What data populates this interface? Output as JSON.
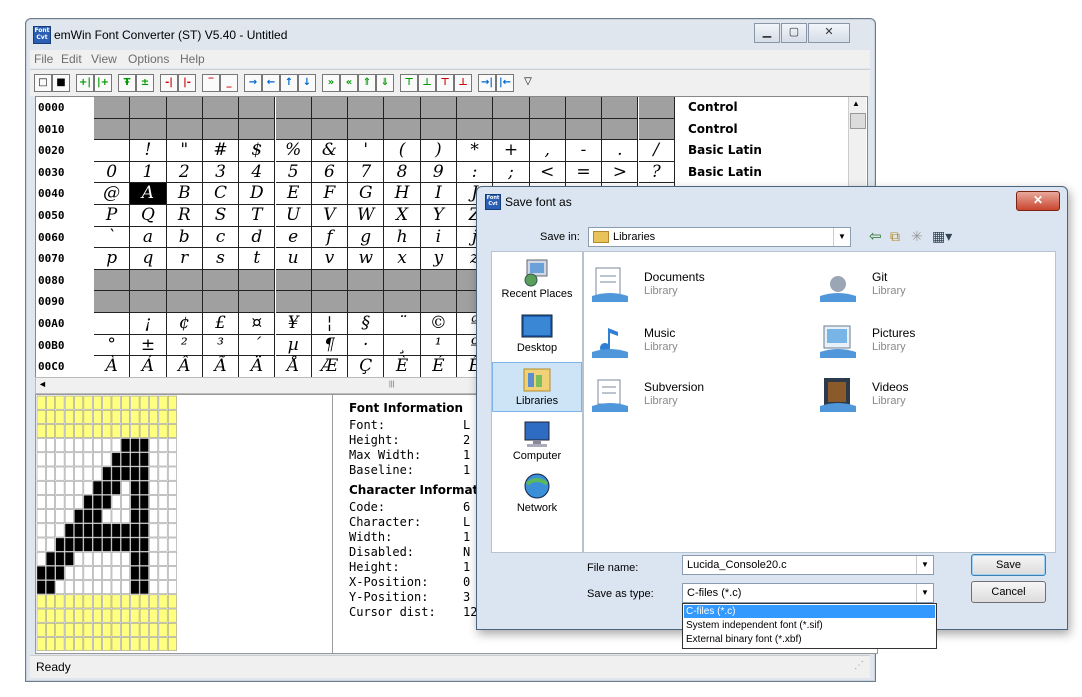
{
  "main_window": {
    "title": "emWin Font Converter (ST) V5.40 - Untitled",
    "menu": [
      "File",
      "Edit",
      "View",
      "Options",
      "Help"
    ],
    "statusbar": "Ready"
  },
  "char_table": {
    "rows": [
      {
        "code": "0000",
        "category": "Control",
        "chars": [
          "",
          "",
          "",
          "",
          "",
          "",
          "",
          "",
          "",
          "",
          "",
          "",
          "",
          "",
          "",
          ""
        ],
        "disabled": true
      },
      {
        "code": "0010",
        "category": "Control",
        "chars": [
          "",
          "",
          "",
          "",
          "",
          "",
          "",
          "",
          "",
          "",
          "",
          "",
          "",
          "",
          "",
          ""
        ],
        "disabled": true
      },
      {
        "code": "0020",
        "category": "Basic Latin",
        "chars": [
          "",
          "!",
          "\"",
          "#",
          "$",
          "%",
          "&",
          "'",
          "(",
          ")",
          "*",
          "+",
          ",",
          "-",
          ".",
          "/"
        ],
        "disabled": false
      },
      {
        "code": "0030",
        "category": "Basic Latin",
        "chars": [
          "0",
          "1",
          "2",
          "3",
          "4",
          "5",
          "6",
          "7",
          "8",
          "9",
          ":",
          ";",
          "<",
          "=",
          ">",
          "?"
        ],
        "disabled": false
      },
      {
        "code": "0040",
        "category": "",
        "chars": [
          "@",
          "A",
          "B",
          "C",
          "D",
          "E",
          "F",
          "G",
          "H",
          "I",
          "J",
          "",
          "",
          "",
          "",
          ""
        ],
        "disabled": false
      },
      {
        "code": "0050",
        "category": "",
        "chars": [
          "P",
          "Q",
          "R",
          "S",
          "T",
          "U",
          "V",
          "W",
          "X",
          "Y",
          "Z",
          "",
          "",
          "",
          "",
          ""
        ],
        "disabled": false
      },
      {
        "code": "0060",
        "category": "",
        "chars": [
          "`",
          "a",
          "b",
          "c",
          "d",
          "e",
          "f",
          "g",
          "h",
          "i",
          "j",
          "",
          "",
          "",
          "",
          ""
        ],
        "disabled": false
      },
      {
        "code": "0070",
        "category": "",
        "chars": [
          "p",
          "q",
          "r",
          "s",
          "t",
          "u",
          "v",
          "w",
          "x",
          "y",
          "z",
          "",
          "",
          "",
          "",
          ""
        ],
        "disabled": false
      },
      {
        "code": "0080",
        "category": "",
        "chars": [
          "",
          "",
          "",
          "",
          "",
          "",
          "",
          "",
          "",
          "",
          "",
          "",
          "",
          "",
          "",
          ""
        ],
        "disabled": true
      },
      {
        "code": "0090",
        "category": "",
        "chars": [
          "",
          "",
          "",
          "",
          "",
          "",
          "",
          "",
          "",
          "",
          "",
          "",
          "",
          "",
          "",
          ""
        ],
        "disabled": true
      },
      {
        "code": "00A0",
        "category": "",
        "chars": [
          "",
          "¡",
          "¢",
          "£",
          "¤",
          "¥",
          "¦",
          "§",
          "¨",
          "©",
          "ª",
          "",
          "",
          "",
          "",
          ""
        ],
        "disabled": false
      },
      {
        "code": "00B0",
        "category": "",
        "chars": [
          "°",
          "±",
          "²",
          "³",
          "´",
          "µ",
          "¶",
          "·",
          "¸",
          "¹",
          "º",
          "",
          "",
          "",
          "",
          ""
        ],
        "disabled": false
      },
      {
        "code": "00C0",
        "category": "",
        "chars": [
          "À",
          "Á",
          "Â",
          "Ã",
          "Ä",
          "Å",
          "Æ",
          "Ç",
          "È",
          "É",
          "Ê",
          "",
          "",
          "",
          "",
          ""
        ],
        "disabled": false
      }
    ],
    "selected": {
      "row": 4,
      "col": 1
    }
  },
  "glyph": {
    "rows": [
      "000000000000000",
      "000000000000000",
      "000000000000000",
      "000000000111000",
      "000000001111000",
      "000000011111000",
      "000000111011000",
      "000001110011000",
      "000011100011000",
      "000111111111000",
      "001111111111000",
      "011100000011000",
      "111000000011000",
      "110000000011000",
      "000000000000000",
      "000000000000000",
      "000000000000000",
      "000000000000000"
    ],
    "lit_rows": [
      0,
      1,
      2,
      14,
      15,
      16,
      17
    ]
  },
  "font_info": {
    "heading": "Font Information",
    "labels": [
      "Font:",
      "Height:",
      "Max Width:",
      "Baseline:"
    ],
    "values": [
      "L",
      "2",
      "1",
      "1"
    ]
  },
  "char_info": {
    "heading": "Character Informati",
    "labels": [
      "Code:",
      "Character:",
      "Width:",
      "Disabled:",
      "Height:",
      "X-Position:",
      "Y-Position:",
      "Cursor dist:"
    ],
    "values": [
      "6",
      "L",
      "1",
      "N",
      "1",
      "0",
      "3",
      "12"
    ]
  },
  "dialog": {
    "title": "Save font as",
    "save_in_label": "Save in:",
    "save_in_value": "Libraries",
    "places": [
      "Recent Places",
      "Desktop",
      "Libraries",
      "Computer",
      "Network"
    ],
    "libraries": [
      {
        "name": "Documents",
        "desc": "Library",
        "icon": "documents-library-icon"
      },
      {
        "name": "Git",
        "desc": "Library",
        "icon": "git-library-icon"
      },
      {
        "name": "Music",
        "desc": "Library",
        "icon": "music-library-icon"
      },
      {
        "name": "Pictures",
        "desc": "Library",
        "icon": "pictures-library-icon"
      },
      {
        "name": "Subversion",
        "desc": "Library",
        "icon": "subversion-library-icon"
      },
      {
        "name": "Videos",
        "desc": "Library",
        "icon": "videos-library-icon"
      }
    ],
    "file_name_label": "File name:",
    "file_name_value": "Lucida_Console20.c",
    "type_label": "Save as type:",
    "type_value": "C-files (*.c)",
    "type_options": [
      "C-files (*.c)",
      "System independent font (*.sif)",
      "External binary font (*.xbf)"
    ],
    "save_button": "Save",
    "cancel_button": "Cancel"
  },
  "colors": {
    "accent": "#3399ff",
    "grid_disabled": "#a0a0a0",
    "glyph_on": "#000000",
    "glyph_lit": "#ffff80"
  }
}
